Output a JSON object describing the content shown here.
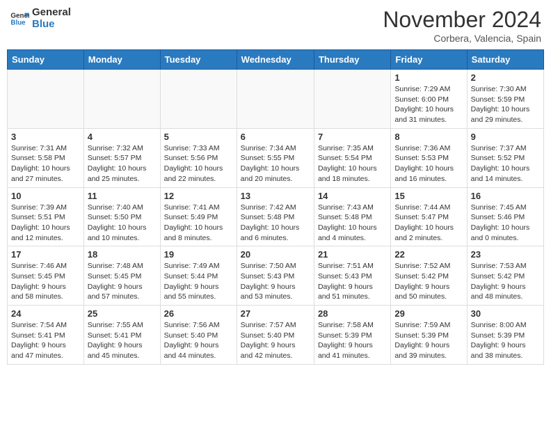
{
  "header": {
    "logo_line1": "General",
    "logo_line2": "Blue",
    "month": "November 2024",
    "location": "Corbera, Valencia, Spain"
  },
  "weekdays": [
    "Sunday",
    "Monday",
    "Tuesday",
    "Wednesday",
    "Thursday",
    "Friday",
    "Saturday"
  ],
  "weeks": [
    [
      {
        "day": "",
        "info": ""
      },
      {
        "day": "",
        "info": ""
      },
      {
        "day": "",
        "info": ""
      },
      {
        "day": "",
        "info": ""
      },
      {
        "day": "",
        "info": ""
      },
      {
        "day": "1",
        "info": "Sunrise: 7:29 AM\nSunset: 6:00 PM\nDaylight: 10 hours\nand 31 minutes."
      },
      {
        "day": "2",
        "info": "Sunrise: 7:30 AM\nSunset: 5:59 PM\nDaylight: 10 hours\nand 29 minutes."
      }
    ],
    [
      {
        "day": "3",
        "info": "Sunrise: 7:31 AM\nSunset: 5:58 PM\nDaylight: 10 hours\nand 27 minutes."
      },
      {
        "day": "4",
        "info": "Sunrise: 7:32 AM\nSunset: 5:57 PM\nDaylight: 10 hours\nand 25 minutes."
      },
      {
        "day": "5",
        "info": "Sunrise: 7:33 AM\nSunset: 5:56 PM\nDaylight: 10 hours\nand 22 minutes."
      },
      {
        "day": "6",
        "info": "Sunrise: 7:34 AM\nSunset: 5:55 PM\nDaylight: 10 hours\nand 20 minutes."
      },
      {
        "day": "7",
        "info": "Sunrise: 7:35 AM\nSunset: 5:54 PM\nDaylight: 10 hours\nand 18 minutes."
      },
      {
        "day": "8",
        "info": "Sunrise: 7:36 AM\nSunset: 5:53 PM\nDaylight: 10 hours\nand 16 minutes."
      },
      {
        "day": "9",
        "info": "Sunrise: 7:37 AM\nSunset: 5:52 PM\nDaylight: 10 hours\nand 14 minutes."
      }
    ],
    [
      {
        "day": "10",
        "info": "Sunrise: 7:39 AM\nSunset: 5:51 PM\nDaylight: 10 hours\nand 12 minutes."
      },
      {
        "day": "11",
        "info": "Sunrise: 7:40 AM\nSunset: 5:50 PM\nDaylight: 10 hours\nand 10 minutes."
      },
      {
        "day": "12",
        "info": "Sunrise: 7:41 AM\nSunset: 5:49 PM\nDaylight: 10 hours\nand 8 minutes."
      },
      {
        "day": "13",
        "info": "Sunrise: 7:42 AM\nSunset: 5:48 PM\nDaylight: 10 hours\nand 6 minutes."
      },
      {
        "day": "14",
        "info": "Sunrise: 7:43 AM\nSunset: 5:48 PM\nDaylight: 10 hours\nand 4 minutes."
      },
      {
        "day": "15",
        "info": "Sunrise: 7:44 AM\nSunset: 5:47 PM\nDaylight: 10 hours\nand 2 minutes."
      },
      {
        "day": "16",
        "info": "Sunrise: 7:45 AM\nSunset: 5:46 PM\nDaylight: 10 hours\nand 0 minutes."
      }
    ],
    [
      {
        "day": "17",
        "info": "Sunrise: 7:46 AM\nSunset: 5:45 PM\nDaylight: 9 hours\nand 58 minutes."
      },
      {
        "day": "18",
        "info": "Sunrise: 7:48 AM\nSunset: 5:45 PM\nDaylight: 9 hours\nand 57 minutes."
      },
      {
        "day": "19",
        "info": "Sunrise: 7:49 AM\nSunset: 5:44 PM\nDaylight: 9 hours\nand 55 minutes."
      },
      {
        "day": "20",
        "info": "Sunrise: 7:50 AM\nSunset: 5:43 PM\nDaylight: 9 hours\nand 53 minutes."
      },
      {
        "day": "21",
        "info": "Sunrise: 7:51 AM\nSunset: 5:43 PM\nDaylight: 9 hours\nand 51 minutes."
      },
      {
        "day": "22",
        "info": "Sunrise: 7:52 AM\nSunset: 5:42 PM\nDaylight: 9 hours\nand 50 minutes."
      },
      {
        "day": "23",
        "info": "Sunrise: 7:53 AM\nSunset: 5:42 PM\nDaylight: 9 hours\nand 48 minutes."
      }
    ],
    [
      {
        "day": "24",
        "info": "Sunrise: 7:54 AM\nSunset: 5:41 PM\nDaylight: 9 hours\nand 47 minutes."
      },
      {
        "day": "25",
        "info": "Sunrise: 7:55 AM\nSunset: 5:41 PM\nDaylight: 9 hours\nand 45 minutes."
      },
      {
        "day": "26",
        "info": "Sunrise: 7:56 AM\nSunset: 5:40 PM\nDaylight: 9 hours\nand 44 minutes."
      },
      {
        "day": "27",
        "info": "Sunrise: 7:57 AM\nSunset: 5:40 PM\nDaylight: 9 hours\nand 42 minutes."
      },
      {
        "day": "28",
        "info": "Sunrise: 7:58 AM\nSunset: 5:39 PM\nDaylight: 9 hours\nand 41 minutes."
      },
      {
        "day": "29",
        "info": "Sunrise: 7:59 AM\nSunset: 5:39 PM\nDaylight: 9 hours\nand 39 minutes."
      },
      {
        "day": "30",
        "info": "Sunrise: 8:00 AM\nSunset: 5:39 PM\nDaylight: 9 hours\nand 38 minutes."
      }
    ]
  ]
}
